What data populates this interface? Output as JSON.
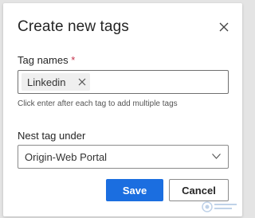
{
  "dialog": {
    "title": "Create new tags",
    "close_icon": "close-icon"
  },
  "tag_names": {
    "label": "Tag names",
    "required_marker": "*",
    "chips": [
      {
        "label": "Linkedin",
        "remove_icon": "close-icon"
      }
    ],
    "helper_text": "Click enter after each tag to add multiple tags"
  },
  "nest_tag": {
    "label": "Nest tag under",
    "selected_value": "Origin-Web Portal",
    "chevron_icon": "chevron-down-icon"
  },
  "actions": {
    "save_label": "Save",
    "cancel_label": "Cancel"
  },
  "colors": {
    "primary": "#1b6ee0",
    "required": "#c4314b",
    "backdrop": "#e4e4e4"
  }
}
